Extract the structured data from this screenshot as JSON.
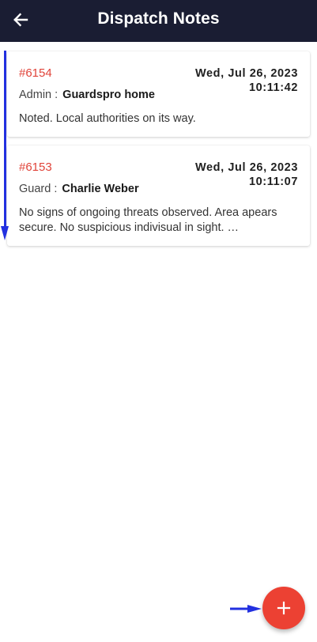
{
  "header": {
    "title": "Dispatch Notes",
    "back_icon": "arrow-left-icon"
  },
  "notes": [
    {
      "id": "#6154",
      "date": "Wed, Jul 26, 2023",
      "time": "10:11:42",
      "role": "Admin :",
      "name": "Guardspro home",
      "body": "Noted. Local authorities on its way."
    },
    {
      "id": "#6153",
      "date": "Wed, Jul 26, 2023",
      "time": "10:11:07",
      "role": "Guard :",
      "name": "Charlie Weber",
      "body": "No signs of ongoing threats observed.  Area apears secure. No suspicious indivisual in sight. …"
    }
  ],
  "fab": {
    "icon": "plus-icon"
  },
  "colors": {
    "header_bg": "#1a1d33",
    "accent_red": "#e0443a",
    "fab_bg": "#ec4133",
    "annotation_blue": "#2230e0"
  }
}
